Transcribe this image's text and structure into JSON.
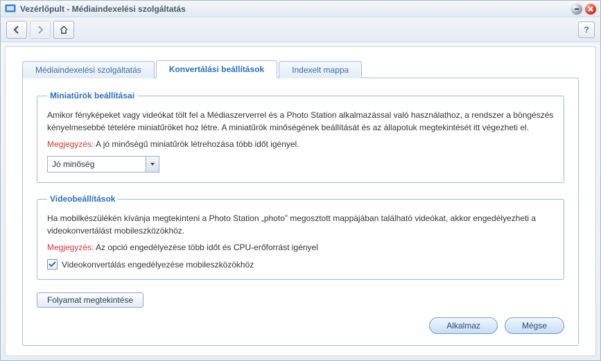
{
  "window": {
    "title": "Vezérlőpult - Médiaindexelési szolgáltatás"
  },
  "toolbar": {
    "help_glyph": "?"
  },
  "tabs": [
    {
      "label": "Médiaindexelési szolgáltatás"
    },
    {
      "label": "Konvertálási beállítások"
    },
    {
      "label": "Indexelt mappa"
    }
  ],
  "thumbnails": {
    "legend": "Miniatűrök beállításai",
    "desc": "Amikor fényképeket vagy videókat tölt fel a Médiaszerverrel és a Photo Station alkalmazással való használathoz, a rendszer a böngészés kényelmesebbé tételére miniatűröket hoz létre. A miniatűrök minőségének beállítását és az állapotuk megtekintését itt végezheti el.",
    "note_label": "Megjegyzés:",
    "note_text": "A jó minőségű miniatűrök létrehozása több időt igényel.",
    "quality_selected": "Jó minőség"
  },
  "video": {
    "legend": "Videobeállítások",
    "desc": "Ha mobilkészülékén kívánja megtekinteni a Photo Station „photo” megosztott mappájában található videókat, akkor engedélyezheti a videokonvertálást mobileszközökhöz.",
    "note_label": "Megjegyzés:",
    "note_text": "Az opció engedélyezése több időt és CPU-erőforrást igényel",
    "checkbox_label": "Videokonvertálás engedélyezése mobileszközökhöz",
    "checkbox_checked": true
  },
  "buttons": {
    "process": "Folyamat megtekintése",
    "apply": "Alkalmaz",
    "cancel": "Mégse"
  }
}
